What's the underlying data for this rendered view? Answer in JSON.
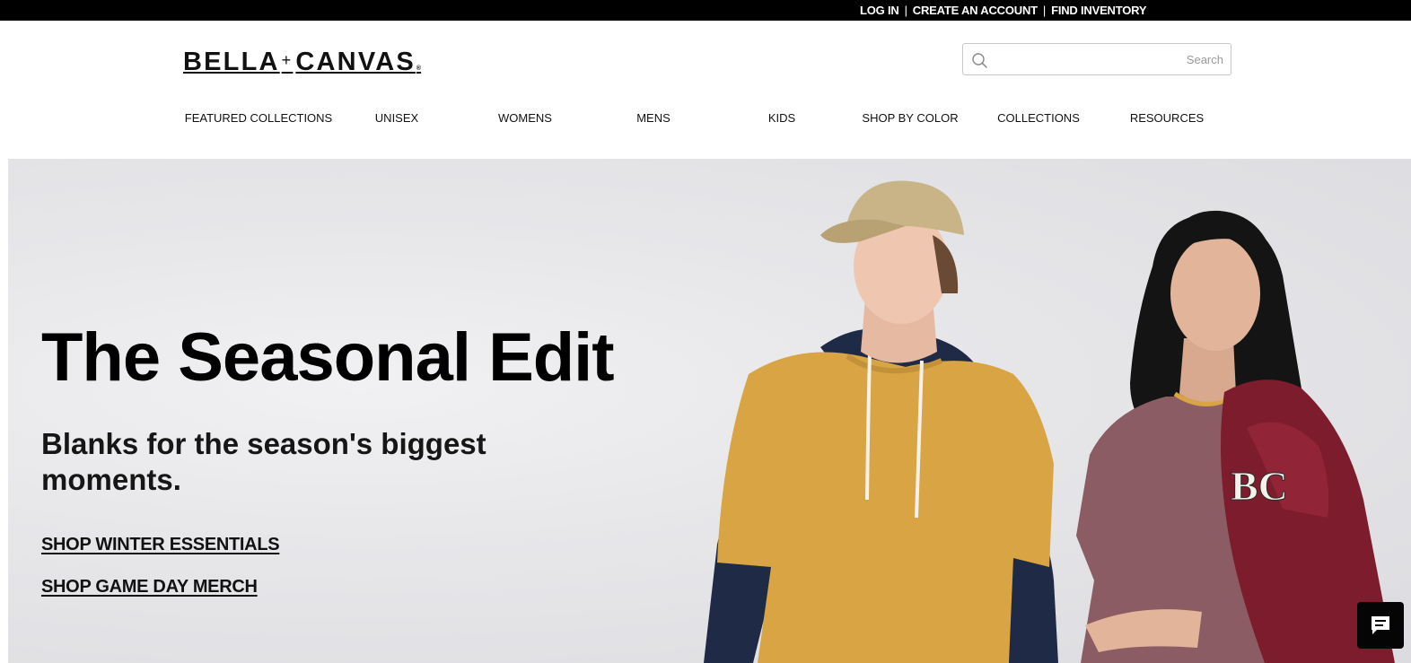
{
  "topbar": {
    "links": [
      {
        "label": "LOG IN"
      },
      {
        "label": "CREATE AN ACCOUNT"
      },
      {
        "label": "FIND INVENTORY"
      }
    ],
    "separator": "|"
  },
  "header": {
    "logo_left": "BELLA",
    "logo_plus": "+",
    "logo_right": "CANVAS",
    "logo_mark": "®",
    "search": {
      "placeholder": "Search",
      "value": "",
      "icon": "search-icon"
    }
  },
  "nav": {
    "items": [
      {
        "label": "FEATURED COLLECTIONS"
      },
      {
        "label": "UNISEX"
      },
      {
        "label": "WOMENS"
      },
      {
        "label": "MENS"
      },
      {
        "label": "KIDS"
      },
      {
        "label": "SHOP BY COLOR"
      },
      {
        "label": "COLLECTIONS"
      },
      {
        "label": "RESOURCES"
      }
    ]
  },
  "hero": {
    "title": "The Seasonal Edit",
    "subtitle": "Blanks for the season's biggest moments.",
    "links": [
      {
        "label": "SHOP WINTER ESSENTIALS"
      },
      {
        "label": "SHOP GAME DAY MERCH"
      }
    ],
    "jacket_letters": "BC"
  },
  "chat": {
    "icon": "chat-icon"
  },
  "colors": {
    "topbar_bg": "#000000",
    "hero_bg": "#e5e5e8",
    "text": "#111111",
    "tee_yellow": "#d8a444",
    "hoodie_navy": "#1f2a47",
    "tee_mauve": "#8c5c64",
    "jacket_red": "#7d1c2c",
    "cap_khaki": "#c9b488"
  }
}
